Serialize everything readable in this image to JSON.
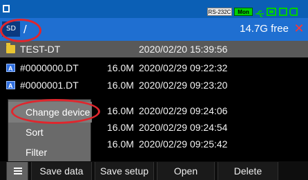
{
  "status": {
    "rs_label": "RS-232C",
    "mon_label": "Mon"
  },
  "pathbar": {
    "drive": "SD",
    "path": "/",
    "free": "14.7G free",
    "close": "✕"
  },
  "files": [
    {
      "name": "TEST-DT",
      "size": "",
      "date": "2020/02/20 15:39:56",
      "type": "folder"
    },
    {
      "name": "#0000000.DT",
      "size": "16.0M",
      "date": "2020/02/29 09:22:32",
      "type": "file"
    },
    {
      "name": "#0000001.DT",
      "size": "16.0M",
      "date": "2020/02/29 09:23:20",
      "type": "file"
    },
    {
      "name": "",
      "size": "16.0M",
      "date": "2020/02/29 09:24:06",
      "type": "file"
    },
    {
      "name": "",
      "size": "16.0M",
      "date": "2020/02/29 09:24:54",
      "type": "file"
    },
    {
      "name": "",
      "size": "16.0M",
      "date": "2020/02/29 09:25:42",
      "type": "file"
    }
  ],
  "menu": [
    "Change device",
    "Sort",
    "Filter"
  ],
  "function_bar": [
    "Save data",
    "Save setup",
    "Open",
    "Delete"
  ]
}
